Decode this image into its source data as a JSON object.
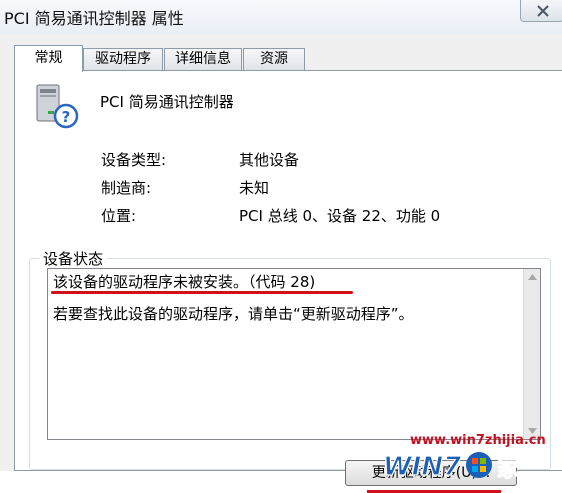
{
  "window": {
    "title": "PCI 简易通讯控制器 属性"
  },
  "tabs": [
    {
      "label": "常规",
      "active": true
    },
    {
      "label": "驱动程序",
      "active": false
    },
    {
      "label": "详细信息",
      "active": false
    },
    {
      "label": "资源",
      "active": false
    }
  ],
  "device": {
    "name": "PCI 简易通讯控制器",
    "icon": "unknown-device-icon"
  },
  "properties": [
    {
      "label": "设备类型:",
      "value": "其他设备"
    },
    {
      "label": "制造商:",
      "value": "未知"
    },
    {
      "label": "位置:",
      "value": "PCI 总线 0、设备 22、功能 0"
    }
  ],
  "status": {
    "group_title": "设备状态",
    "lines": [
      "该设备的驱动程序未被安装。（代码 28)",
      "若要查找此设备的驱动程序，请单击“更新驱动程序”。"
    ]
  },
  "buttons": {
    "update_driver": "更新驱动程序(U)..."
  },
  "watermark": {
    "url": "www.win7zhijia.cn",
    "logo_text": "WIN7之家"
  },
  "colors": {
    "annotation_red": "#d0101a",
    "watermark_blue": "#1c5fb7"
  }
}
